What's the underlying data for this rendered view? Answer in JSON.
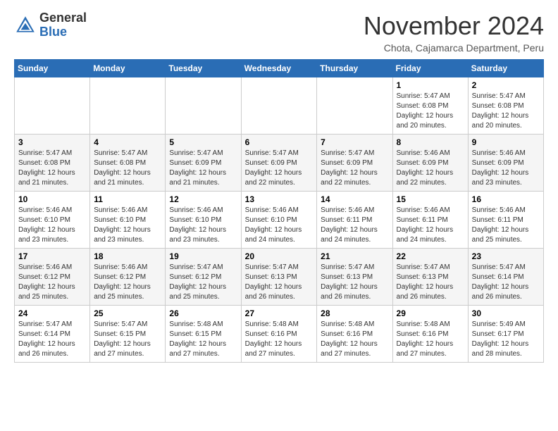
{
  "header": {
    "logo_general": "General",
    "logo_blue": "Blue",
    "month_title": "November 2024",
    "location": "Chota, Cajamarca Department, Peru"
  },
  "days_of_week": [
    "Sunday",
    "Monday",
    "Tuesday",
    "Wednesday",
    "Thursday",
    "Friday",
    "Saturday"
  ],
  "weeks": [
    [
      {
        "day": "",
        "info": ""
      },
      {
        "day": "",
        "info": ""
      },
      {
        "day": "",
        "info": ""
      },
      {
        "day": "",
        "info": ""
      },
      {
        "day": "",
        "info": ""
      },
      {
        "day": "1",
        "info": "Sunrise: 5:47 AM\nSunset: 6:08 PM\nDaylight: 12 hours and 20 minutes."
      },
      {
        "day": "2",
        "info": "Sunrise: 5:47 AM\nSunset: 6:08 PM\nDaylight: 12 hours and 20 minutes."
      }
    ],
    [
      {
        "day": "3",
        "info": "Sunrise: 5:47 AM\nSunset: 6:08 PM\nDaylight: 12 hours and 21 minutes."
      },
      {
        "day": "4",
        "info": "Sunrise: 5:47 AM\nSunset: 6:08 PM\nDaylight: 12 hours and 21 minutes."
      },
      {
        "day": "5",
        "info": "Sunrise: 5:47 AM\nSunset: 6:09 PM\nDaylight: 12 hours and 21 minutes."
      },
      {
        "day": "6",
        "info": "Sunrise: 5:47 AM\nSunset: 6:09 PM\nDaylight: 12 hours and 22 minutes."
      },
      {
        "day": "7",
        "info": "Sunrise: 5:47 AM\nSunset: 6:09 PM\nDaylight: 12 hours and 22 minutes."
      },
      {
        "day": "8",
        "info": "Sunrise: 5:46 AM\nSunset: 6:09 PM\nDaylight: 12 hours and 22 minutes."
      },
      {
        "day": "9",
        "info": "Sunrise: 5:46 AM\nSunset: 6:09 PM\nDaylight: 12 hours and 23 minutes."
      }
    ],
    [
      {
        "day": "10",
        "info": "Sunrise: 5:46 AM\nSunset: 6:10 PM\nDaylight: 12 hours and 23 minutes."
      },
      {
        "day": "11",
        "info": "Sunrise: 5:46 AM\nSunset: 6:10 PM\nDaylight: 12 hours and 23 minutes."
      },
      {
        "day": "12",
        "info": "Sunrise: 5:46 AM\nSunset: 6:10 PM\nDaylight: 12 hours and 23 minutes."
      },
      {
        "day": "13",
        "info": "Sunrise: 5:46 AM\nSunset: 6:10 PM\nDaylight: 12 hours and 24 minutes."
      },
      {
        "day": "14",
        "info": "Sunrise: 5:46 AM\nSunset: 6:11 PM\nDaylight: 12 hours and 24 minutes."
      },
      {
        "day": "15",
        "info": "Sunrise: 5:46 AM\nSunset: 6:11 PM\nDaylight: 12 hours and 24 minutes."
      },
      {
        "day": "16",
        "info": "Sunrise: 5:46 AM\nSunset: 6:11 PM\nDaylight: 12 hours and 25 minutes."
      }
    ],
    [
      {
        "day": "17",
        "info": "Sunrise: 5:46 AM\nSunset: 6:12 PM\nDaylight: 12 hours and 25 minutes."
      },
      {
        "day": "18",
        "info": "Sunrise: 5:46 AM\nSunset: 6:12 PM\nDaylight: 12 hours and 25 minutes."
      },
      {
        "day": "19",
        "info": "Sunrise: 5:47 AM\nSunset: 6:12 PM\nDaylight: 12 hours and 25 minutes."
      },
      {
        "day": "20",
        "info": "Sunrise: 5:47 AM\nSunset: 6:13 PM\nDaylight: 12 hours and 26 minutes."
      },
      {
        "day": "21",
        "info": "Sunrise: 5:47 AM\nSunset: 6:13 PM\nDaylight: 12 hours and 26 minutes."
      },
      {
        "day": "22",
        "info": "Sunrise: 5:47 AM\nSunset: 6:13 PM\nDaylight: 12 hours and 26 minutes."
      },
      {
        "day": "23",
        "info": "Sunrise: 5:47 AM\nSunset: 6:14 PM\nDaylight: 12 hours and 26 minutes."
      }
    ],
    [
      {
        "day": "24",
        "info": "Sunrise: 5:47 AM\nSunset: 6:14 PM\nDaylight: 12 hours and 26 minutes."
      },
      {
        "day": "25",
        "info": "Sunrise: 5:47 AM\nSunset: 6:15 PM\nDaylight: 12 hours and 27 minutes."
      },
      {
        "day": "26",
        "info": "Sunrise: 5:48 AM\nSunset: 6:15 PM\nDaylight: 12 hours and 27 minutes."
      },
      {
        "day": "27",
        "info": "Sunrise: 5:48 AM\nSunset: 6:16 PM\nDaylight: 12 hours and 27 minutes."
      },
      {
        "day": "28",
        "info": "Sunrise: 5:48 AM\nSunset: 6:16 PM\nDaylight: 12 hours and 27 minutes."
      },
      {
        "day": "29",
        "info": "Sunrise: 5:48 AM\nSunset: 6:16 PM\nDaylight: 12 hours and 27 minutes."
      },
      {
        "day": "30",
        "info": "Sunrise: 5:49 AM\nSunset: 6:17 PM\nDaylight: 12 hours and 28 minutes."
      }
    ]
  ]
}
